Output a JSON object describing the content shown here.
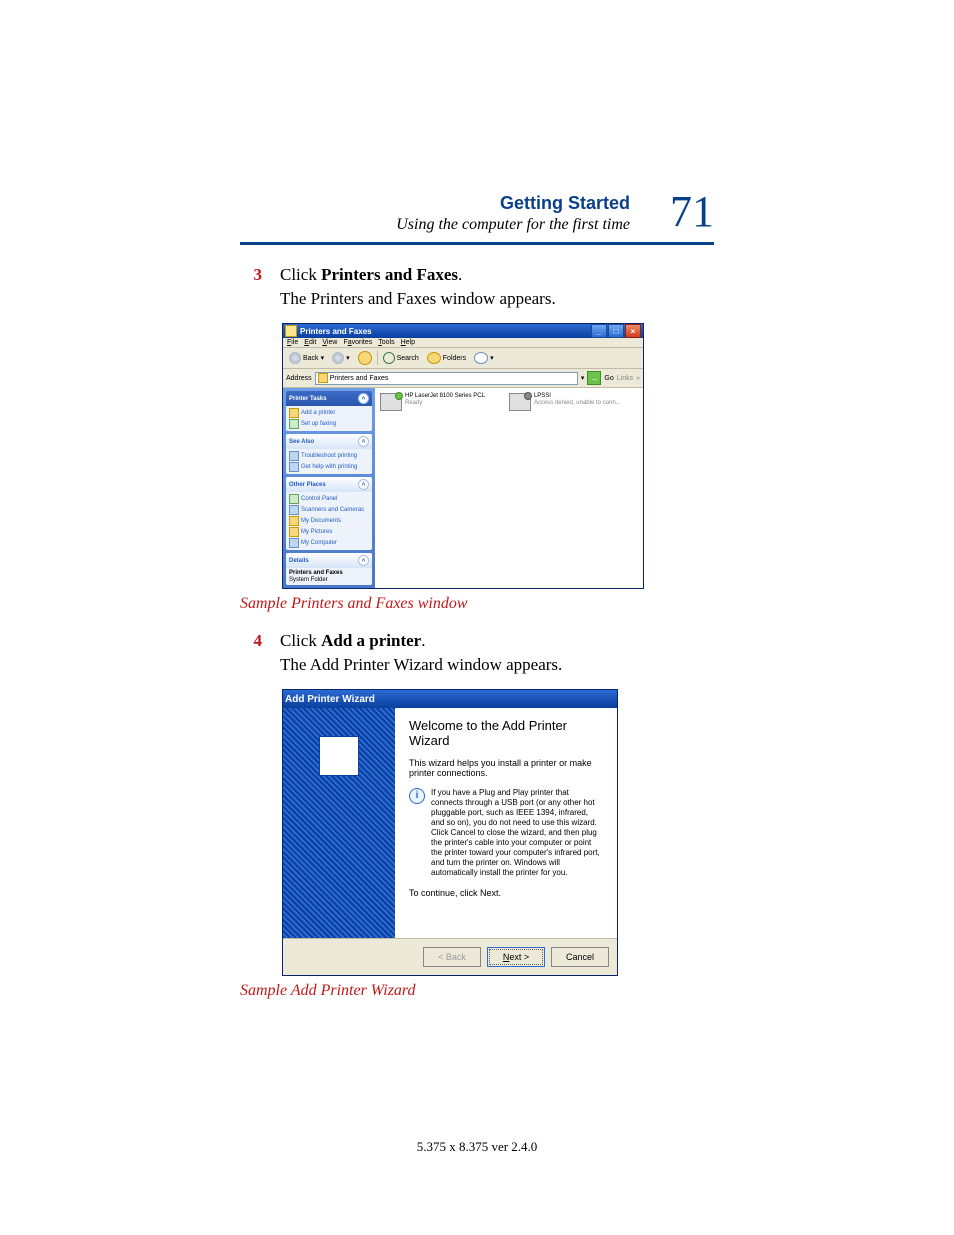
{
  "header": {
    "section": "Getting Started",
    "subtitle": "Using the computer for the first time",
    "page_number": "71"
  },
  "steps": {
    "s3": {
      "num": "3",
      "lead": "Click ",
      "bold": "Printers and Faxes",
      "tail": ".",
      "para": "The Printers and Faxes window appears."
    },
    "s4": {
      "num": "4",
      "lead": "Click ",
      "bold": "Add a printer",
      "tail": ".",
      "para": "The Add Printer Wizard window appears."
    }
  },
  "captions": {
    "c1": "Sample Printers and Faxes window",
    "c2": "Sample Add Printer Wizard"
  },
  "footer": "5.375 x 8.375 ver 2.4.0",
  "win1": {
    "title": "Printers and Faxes",
    "menus": {
      "file": "File",
      "edit": "Edit",
      "view": "View",
      "favorites": "Favorites",
      "tools": "Tools",
      "help": "Help"
    },
    "toolbar": {
      "back": "Back",
      "search": "Search",
      "folders": "Folders"
    },
    "address": {
      "label": "Address",
      "value": "Printers and Faxes",
      "go": "Go",
      "links": "Links"
    },
    "tasks": {
      "printerTasksTitle": "Printer Tasks",
      "addPrinter": "Add a printer",
      "setupFaxing": "Set up faxing",
      "seeAlsoTitle": "See Also",
      "troubleshoot": "Troubleshoot printing",
      "getHelp": "Get help with printing",
      "otherPlacesTitle": "Other Places",
      "controlPanel": "Control Panel",
      "scanners": "Scanners and Cameras",
      "myDocs": "My Documents",
      "myPics": "My Pictures",
      "myComp": "My Computer",
      "detailsTitle": "Details",
      "detailsName": "Printers and Faxes",
      "detailsType": "System Folder"
    },
    "printers": {
      "p1": {
        "name": "HP LaserJet 8100 Series PCL",
        "status": "Ready"
      },
      "p2": {
        "name": "LPSSI",
        "status": "Access denied, unable to conn..."
      }
    }
  },
  "win2": {
    "title": "Add Printer Wizard",
    "heading": "Welcome to the Add Printer Wizard",
    "p1": "This wizard helps you install a printer or make printer connections.",
    "note": "If you have a Plug and Play printer that connects through a USB port (or any other hot pluggable port, such as IEEE 1394, infrared, and so on), you do not need to use this wizard. Click Cancel to close the wizard, and then plug the printer's cable into your computer or point the printer toward your computer's infrared port, and turn the printer on. Windows will automatically install the printer for you.",
    "p2": "To continue, click Next.",
    "buttons": {
      "back": "< Back",
      "next": "Next >",
      "cancel": "Cancel"
    }
  }
}
